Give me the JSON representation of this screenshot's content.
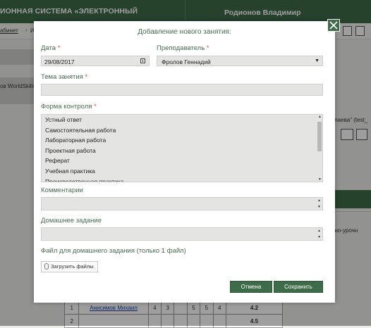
{
  "background": {
    "system_title": "ИОННАЯ СИСТЕМА «ЭЛЕКТРОННЫЙ",
    "user_name": "Родионов Владимир",
    "breadcrumb_first": "абинет",
    "breadcrumb_sep": "›",
    "breadcrumb_second": "И",
    "side_label": "ов WorldSkills",
    "right_text_1": "лаева\" (test_",
    "right_text_2": "ессно-урочн",
    "table_rows": [
      {
        "num": "1",
        "name": "Анисимов Михаил",
        "c1": "4",
        "c2": "3",
        "c3": "",
        "c4": "5",
        "c5": "5",
        "c6": "4",
        "avg": "4.2"
      },
      {
        "num": "2",
        "name": "",
        "c1": "",
        "c2": "",
        "c3": "",
        "c4": "",
        "c5": "",
        "c6": "",
        "avg": "4.5"
      }
    ]
  },
  "modal": {
    "title": "Добавление нового занятия:",
    "date_label": "Дата",
    "date_value": "29/08/2017",
    "teacher_label": "Преподаватель",
    "teacher_value": "Фролов Геннадий",
    "topic_label": "Тема занятия",
    "topic_value": "",
    "control_form_label": "Форма контроля",
    "required_mark": "*",
    "control_form_options": [
      "Устный ответ",
      "Самостоятельная работа",
      "Лабораторная работа",
      "Проектная работа",
      "Реферат",
      "Учебная практика",
      "Производственная практика"
    ],
    "comments_label": "Комментарии",
    "comments_value": "",
    "homework_label": "Домашнее задание",
    "homework_value": "",
    "homework_file_label": "Файл для домашнего задания (только 1 файл)",
    "upload_label": "Загрузить файлы",
    "cancel_label": "Отмена",
    "save_label": "Сохранить"
  },
  "colors": {
    "accent_green": "#3e6b4a",
    "label_green": "#4b6b52",
    "required_red": "#d9534f",
    "field_gray": "#e4e5e3"
  },
  "icons": [
    "close-icon",
    "calendar-icon",
    "chevron-down-icon",
    "paperclip-icon"
  ]
}
